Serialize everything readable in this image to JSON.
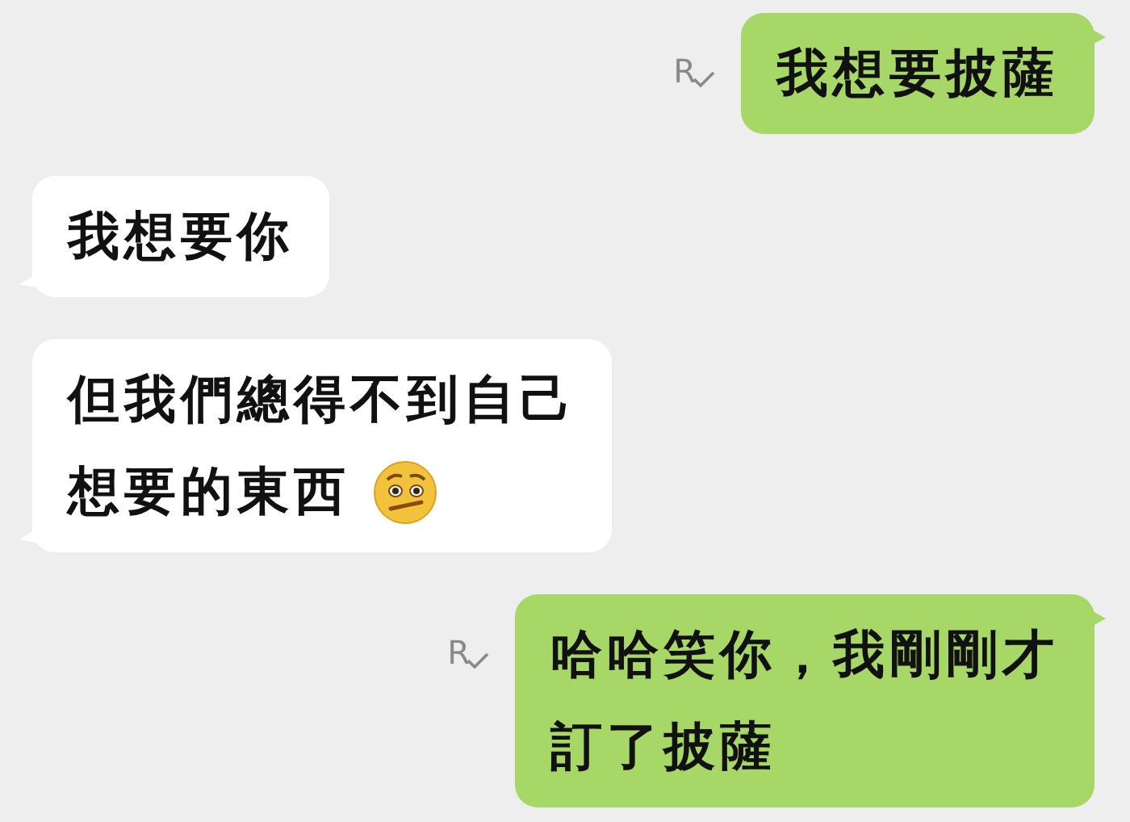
{
  "messages": [
    {
      "kind": "outgoing",
      "lines": [
        "我想要披薩"
      ],
      "receipt": "R"
    },
    {
      "kind": "incoming",
      "lines": [
        "我想要你"
      ]
    },
    {
      "kind": "incoming",
      "lines": [
        "但我們總得不到自己",
        "想要的東西"
      ],
      "emoji": true
    },
    {
      "kind": "outgoing",
      "lines": [
        "哈哈笑你，我剛剛才",
        "訂了披薩"
      ],
      "receipt": "R"
    }
  ]
}
